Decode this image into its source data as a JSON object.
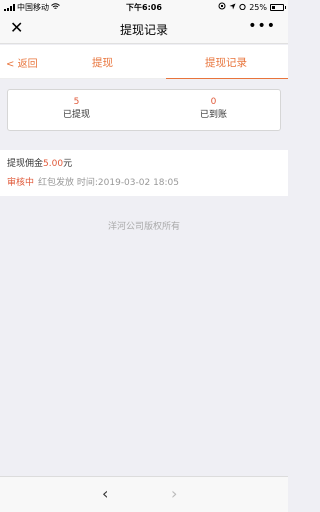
{
  "status_bar": {
    "carrier": "中国移动",
    "time": "下午6:06",
    "battery": "25%"
  },
  "nav": {
    "title": "提现记录",
    "close_icon": "close-icon",
    "more_label": "•••"
  },
  "tabs": {
    "back": "返回",
    "tab1": "提现",
    "tab2": "提现记录"
  },
  "stats": [
    {
      "value": "5",
      "label": "已提现"
    },
    {
      "value": "0",
      "label": "已到账"
    }
  ],
  "record": {
    "prefix": "提现佣金",
    "amount": "5.00",
    "suffix": "元",
    "status": "审核中",
    "detail": "红包发放 时间:2019-03-02 18:05"
  },
  "footer": "洋河公司版权所有",
  "colors": {
    "accent": "#e8743b",
    "amount": "#e05a3a"
  }
}
